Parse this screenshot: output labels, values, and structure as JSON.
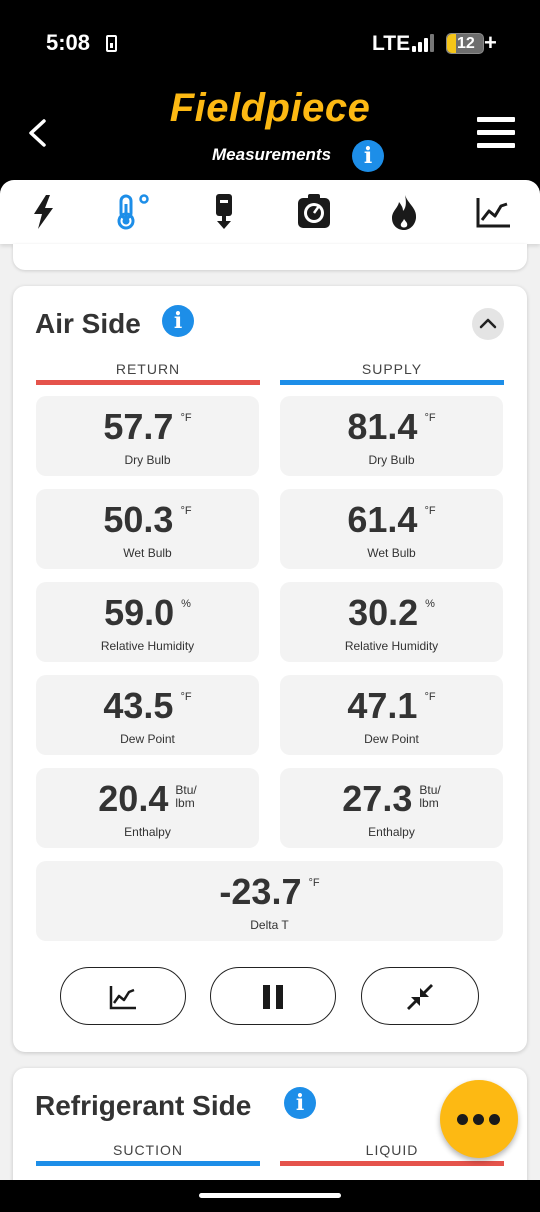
{
  "status_bar": {
    "time": "5:08",
    "network": "LTE",
    "battery": "12"
  },
  "header": {
    "logo": "Fieldpiece",
    "subtitle": "Measurements"
  },
  "tabs": [
    {
      "icon": "lightning-icon"
    },
    {
      "icon": "thermometer-icon",
      "active": true
    },
    {
      "icon": "probe-icon"
    },
    {
      "icon": "gauge-icon"
    },
    {
      "icon": "flame-icon"
    },
    {
      "icon": "chart-icon"
    }
  ],
  "colors": {
    "accent_blue": "#1d8ee8",
    "return_red": "#e5534b",
    "supply_blue": "#1d8ee8",
    "brand_yellow": "#fdb913"
  },
  "air_side": {
    "title": "Air Side",
    "return_label": "RETURN",
    "supply_label": "SUPPLY",
    "return": {
      "dry_bulb": {
        "value": "57.7",
        "unit": "°F",
        "label": "Dry Bulb"
      },
      "wet_bulb": {
        "value": "50.3",
        "unit": "°F",
        "label": "Wet Bulb"
      },
      "rh": {
        "value": "59.0",
        "unit": "%",
        "label": "Relative Humidity"
      },
      "dew_point": {
        "value": "43.5",
        "unit": "°F",
        "label": "Dew Point"
      },
      "enthalpy": {
        "value": "20.4",
        "unit_top": "Btu/",
        "unit_bottom": "lbm",
        "label": "Enthalpy"
      }
    },
    "supply": {
      "dry_bulb": {
        "value": "81.4",
        "unit": "°F",
        "label": "Dry Bulb"
      },
      "wet_bulb": {
        "value": "61.4",
        "unit": "°F",
        "label": "Wet Bulb"
      },
      "rh": {
        "value": "30.2",
        "unit": "%",
        "label": "Relative Humidity"
      },
      "dew_point": {
        "value": "47.1",
        "unit": "°F",
        "label": "Dew Point"
      },
      "enthalpy": {
        "value": "27.3",
        "unit_top": "Btu/",
        "unit_bottom": "lbm",
        "label": "Enthalpy"
      }
    },
    "delta_t": {
      "value": "-23.7",
      "unit": "°F",
      "label": "Delta T"
    },
    "actions": [
      "chart-icon",
      "pause-icon",
      "minimize-icon"
    ]
  },
  "refrigerant_side": {
    "title": "Refrigerant Side",
    "suction_label": "SUCTION",
    "liquid_label": "LIQUID"
  }
}
